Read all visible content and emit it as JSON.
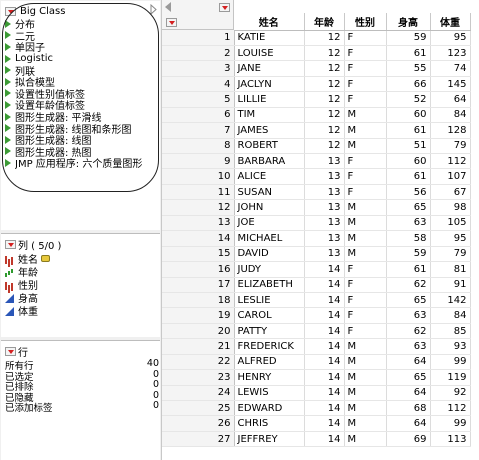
{
  "table_panel": {
    "title": "Big Class",
    "scripts": [
      "分布",
      "二元",
      "单因子",
      "Logistic",
      "列联",
      "拟合模型",
      "设置性别值标签",
      "设置年龄值标签",
      "图形生成器: 平滑线",
      "图形生成器: 线图和条形图",
      "图形生成器: 线图",
      "图形生成器: 热图",
      "JMP 应用程序: 六个质量图形"
    ]
  },
  "columns_panel": {
    "title": "列 ( 5/0 )",
    "columns": [
      {
        "name": "姓名",
        "type": "nominal-icon",
        "has_label_tag": true
      },
      {
        "name": "年龄",
        "type": "ordinal-icon"
      },
      {
        "name": "性别",
        "type": "nominal-icon"
      },
      {
        "name": "身高",
        "type": "continuous-icon"
      },
      {
        "name": "体重",
        "type": "continuous-icon"
      }
    ]
  },
  "rows_panel": {
    "title": "行",
    "items": [
      {
        "label": "所有行",
        "value": "40"
      },
      {
        "label": "已选定",
        "value": "0"
      },
      {
        "label": "已排除",
        "value": "0"
      },
      {
        "label": "已隐藏",
        "value": "0"
      },
      {
        "label": "已添加标签",
        "value": "0"
      }
    ]
  },
  "grid": {
    "headers": [
      "姓名",
      "年龄",
      "性别",
      "身高",
      "体重"
    ],
    "rows": [
      [
        "1",
        "KATIE",
        "12",
        "F",
        "59",
        "95"
      ],
      [
        "2",
        "LOUISE",
        "12",
        "F",
        "61",
        "123"
      ],
      [
        "3",
        "JANE",
        "12",
        "F",
        "55",
        "74"
      ],
      [
        "4",
        "JACLYN",
        "12",
        "F",
        "66",
        "145"
      ],
      [
        "5",
        "LILLIE",
        "12",
        "F",
        "52",
        "64"
      ],
      [
        "6",
        "TIM",
        "12",
        "M",
        "60",
        "84"
      ],
      [
        "7",
        "JAMES",
        "12",
        "M",
        "61",
        "128"
      ],
      [
        "8",
        "ROBERT",
        "12",
        "M",
        "51",
        "79"
      ],
      [
        "9",
        "BARBARA",
        "13",
        "F",
        "60",
        "112"
      ],
      [
        "10",
        "ALICE",
        "13",
        "F",
        "61",
        "107"
      ],
      [
        "11",
        "SUSAN",
        "13",
        "F",
        "56",
        "67"
      ],
      [
        "12",
        "JOHN",
        "13",
        "M",
        "65",
        "98"
      ],
      [
        "13",
        "JOE",
        "13",
        "M",
        "63",
        "105"
      ],
      [
        "14",
        "MICHAEL",
        "13",
        "M",
        "58",
        "95"
      ],
      [
        "15",
        "DAVID",
        "13",
        "M",
        "59",
        "79"
      ],
      [
        "16",
        "JUDY",
        "14",
        "F",
        "61",
        "81"
      ],
      [
        "17",
        "ELIZABETH",
        "14",
        "F",
        "62",
        "91"
      ],
      [
        "18",
        "LESLIE",
        "14",
        "F",
        "65",
        "142"
      ],
      [
        "19",
        "CAROL",
        "14",
        "F",
        "63",
        "84"
      ],
      [
        "20",
        "PATTY",
        "14",
        "F",
        "62",
        "85"
      ],
      [
        "21",
        "FREDERICK",
        "14",
        "M",
        "63",
        "93"
      ],
      [
        "22",
        "ALFRED",
        "14",
        "M",
        "64",
        "99"
      ],
      [
        "23",
        "HENRY",
        "14",
        "M",
        "65",
        "119"
      ],
      [
        "24",
        "LEWIS",
        "14",
        "M",
        "64",
        "92"
      ],
      [
        "25",
        "EDWARD",
        "14",
        "M",
        "68",
        "112"
      ],
      [
        "26",
        "CHRIS",
        "14",
        "M",
        "64",
        "99"
      ],
      [
        "27",
        "JEFFREY",
        "14",
        "M",
        "69",
        "113"
      ]
    ]
  }
}
